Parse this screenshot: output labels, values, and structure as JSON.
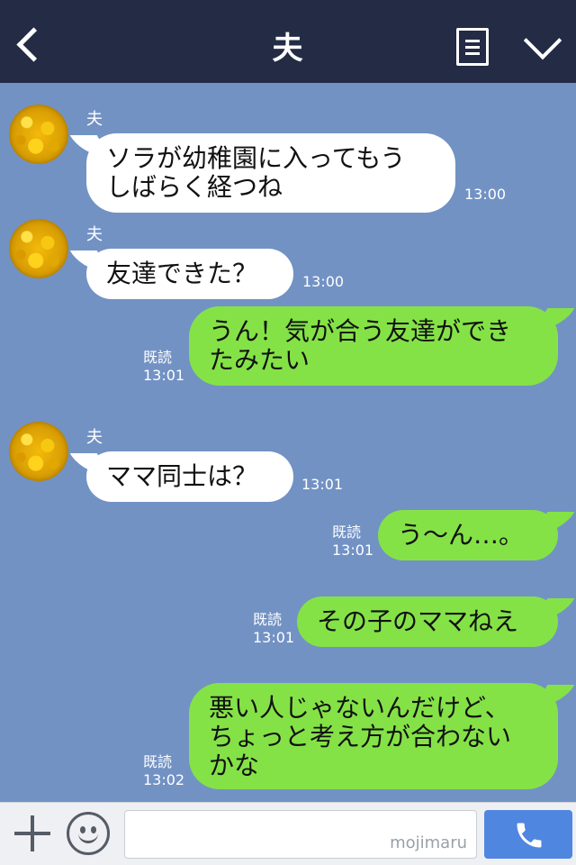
{
  "header": {
    "title": "夫",
    "back_icon": "chevron-left-icon",
    "menu_icon": "note-icon",
    "dropdown_icon": "chevron-down-icon"
  },
  "messages": [
    {
      "side": "in",
      "sender": "夫",
      "lines": [
        "ソラが幼稚園に入ってもう",
        "しばらく経つね"
      ],
      "time": "13:00"
    },
    {
      "side": "in",
      "sender": "夫",
      "lines": [
        "友達できた？"
      ],
      "time": "13:00"
    },
    {
      "side": "out",
      "read": "既読",
      "lines": [
        "うん！気が合う友達ができ",
        "たみたい"
      ],
      "time": "13:01"
    },
    {
      "side": "in",
      "sender": "夫",
      "lines": [
        "ママ同士は？"
      ],
      "time": "13:01"
    },
    {
      "side": "out",
      "read": "既読",
      "lines": [
        "う〜ん…。"
      ],
      "time": "13:01"
    },
    {
      "side": "out",
      "read": "既読",
      "lines": [
        "その子のママねえ"
      ],
      "time": "13:01"
    },
    {
      "side": "out",
      "read": "既読",
      "lines": [
        "悪い人じゃないんだけど、",
        "ちょっと考え方が合わない",
        "かな"
      ],
      "time": "13:02"
    }
  ],
  "input": {
    "watermark": "mojimaru"
  },
  "colors": {
    "header_bg": "#232b45",
    "chat_bg": "#7292c4",
    "incoming_bubble": "#ffffff",
    "outgoing_bubble": "#84e247",
    "call_button": "#4f86e0"
  }
}
